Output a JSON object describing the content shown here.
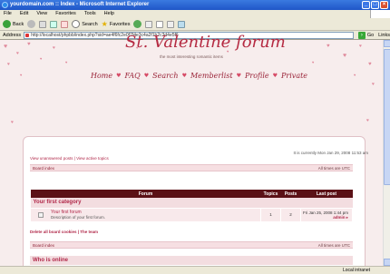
{
  "window": {
    "title": "yourdomain.com :: Index - Microsoft Internet Explorer",
    "controls": [
      "_",
      "□",
      "×"
    ]
  },
  "menu": [
    "File",
    "Edit",
    "View",
    "Favorites",
    "Tools",
    "Help"
  ],
  "toolbar": {
    "back": "Back",
    "search": "Search",
    "favorites": "Favorites"
  },
  "address": {
    "label": "Address",
    "url": "http://localhost/phpbb/index.php?sid=ae4f6fc2e0f7f4e3c4a2f1b2c3d4e5f6",
    "go": "Go",
    "links": "Links"
  },
  "status": {
    "zone": "Local intranet"
  },
  "page": {
    "title": "St. Valentine forum",
    "subtitle": "the most interesting romantic items",
    "nav": [
      "Home",
      "FAQ",
      "Search",
      "Memberlist",
      "Profile",
      "Private"
    ],
    "time": "It is currently Mon Jan 29, 2008 11:53 am",
    "top_links": "View unanswered posts | View active topics",
    "board_index": "Board index",
    "timezone": "All times are UTC",
    "columns": [
      "Forum",
      "Topics",
      "Posts",
      "Last post"
    ],
    "category": "Your first category",
    "forum": {
      "name": "Your first forum",
      "description": "Description of your first forum.",
      "topics": "1",
      "posts": "2",
      "last_post_date": "Fri Jan 25, 2008 1:44 pm",
      "last_post_by": "admin"
    },
    "bottom_links": "Delete all board cookies | The team",
    "board_index_2": "Board index",
    "timezone_2": "All times are UTC",
    "who_online": "Who is online"
  },
  "colors": {
    "accent": "#b1294a",
    "header": "#5b1116"
  }
}
